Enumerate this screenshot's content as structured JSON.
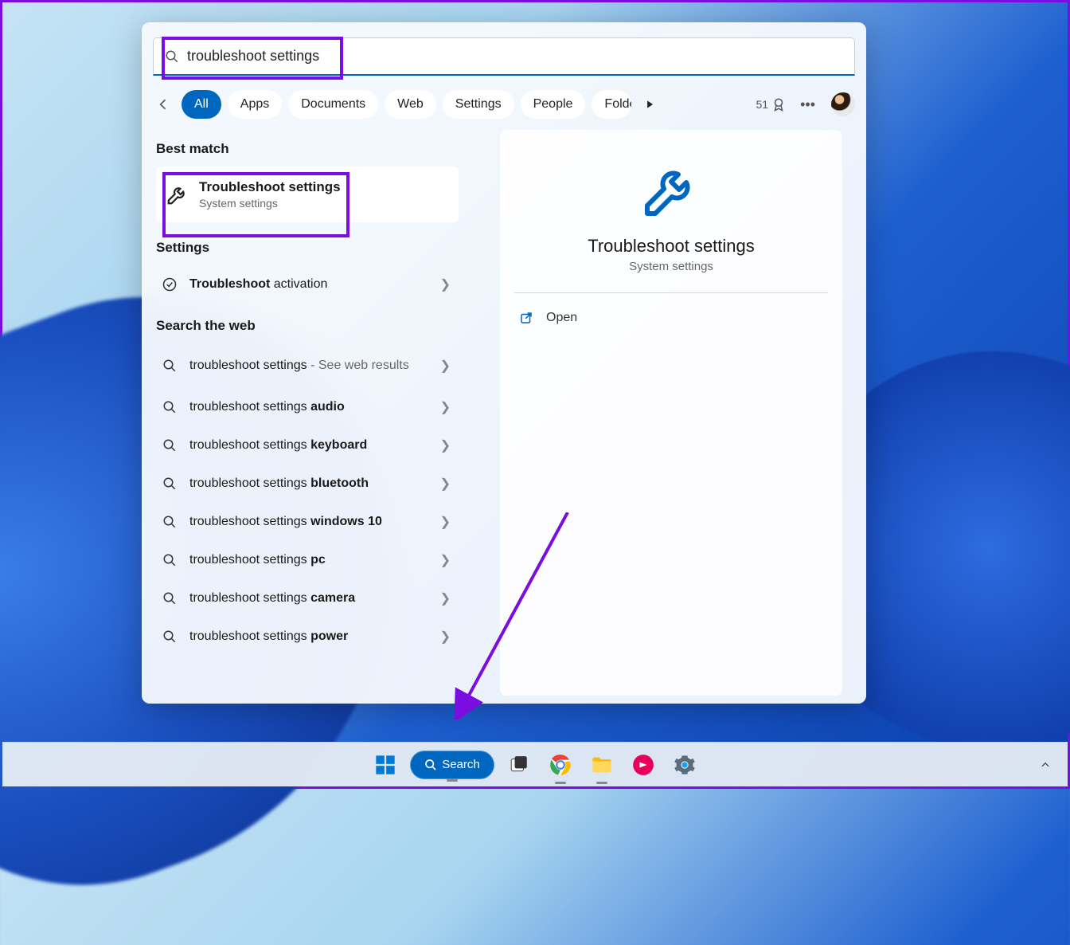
{
  "search": {
    "query": "troubleshoot settings"
  },
  "filters": {
    "items": [
      "All",
      "Apps",
      "Documents",
      "Web",
      "Settings",
      "People",
      "Folders"
    ],
    "active_index": 0
  },
  "rewards": {
    "points": "51"
  },
  "sections": {
    "best_match": "Best match",
    "settings": "Settings",
    "search_web": "Search the web"
  },
  "best_match_item": {
    "title": "Troubleshoot settings",
    "subtitle": "System settings"
  },
  "settings_items": [
    {
      "prefix_bold": "Troubleshoot",
      "suffix": " activation"
    }
  ],
  "web_items": [
    {
      "prefix": "troubleshoot settings",
      "suffix_plain": " - See web results",
      "bold": ""
    },
    {
      "prefix": "troubleshoot settings ",
      "bold": "audio"
    },
    {
      "prefix": "troubleshoot settings ",
      "bold": "keyboard"
    },
    {
      "prefix": "troubleshoot settings ",
      "bold": "bluetooth"
    },
    {
      "prefix": "troubleshoot settings ",
      "bold": "windows 10"
    },
    {
      "prefix": "troubleshoot settings ",
      "bold": "pc"
    },
    {
      "prefix": "troubleshoot settings ",
      "bold": "camera"
    },
    {
      "prefix": "troubleshoot settings ",
      "bold": "power"
    }
  ],
  "detail": {
    "title": "Troubleshoot settings",
    "subtitle": "System settings",
    "open": "Open"
  },
  "taskbar": {
    "search_label": "Search"
  }
}
